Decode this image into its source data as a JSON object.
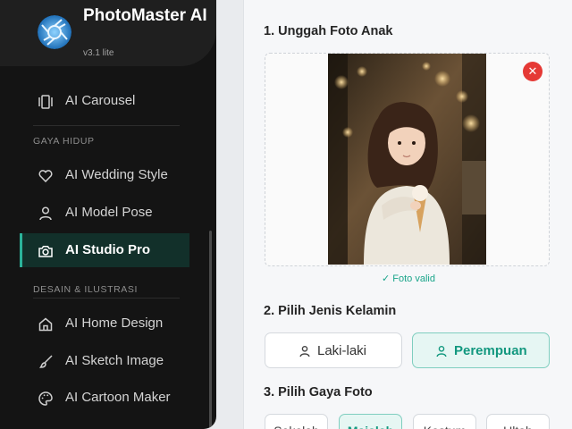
{
  "app": {
    "name": "PhotoMaster AI",
    "version": "v3.1 lite"
  },
  "sidebar": {
    "items": [
      {
        "label": "AI Carousel",
        "icon": "carousel-icon"
      },
      {
        "label": "AI Wedding Style",
        "icon": "heart-icon"
      },
      {
        "label": "AI Model Pose",
        "icon": "person-icon"
      },
      {
        "label": "AI Studio Pro",
        "icon": "camera-icon",
        "active": true
      },
      {
        "label": "AI Home Design",
        "icon": "home-icon"
      },
      {
        "label": "AI Sketch Image",
        "icon": "brush-icon"
      },
      {
        "label": "AI Cartoon Maker",
        "icon": "palette-icon"
      }
    ],
    "sections": [
      {
        "label": "GAYA HIDUP"
      },
      {
        "label": "DESAIN & ILUSTRASI"
      }
    ]
  },
  "main": {
    "upload": {
      "title": "1. Unggah Foto Anak",
      "remove_label": "✕",
      "status": "✓ Foto valid"
    },
    "gender": {
      "title": "2. Pilih Jenis Kelamin",
      "options": [
        {
          "label": "Laki-laki",
          "selected": false
        },
        {
          "label": "Perempuan",
          "selected": true
        }
      ]
    },
    "style": {
      "title": "3. Pilih Gaya Foto",
      "options": [
        {
          "label": "Sekolah",
          "selected": false
        },
        {
          "label": "Majalah",
          "selected": true
        },
        {
          "label": "Kostum",
          "selected": false
        },
        {
          "label": "Ultah",
          "selected": false
        }
      ]
    }
  },
  "colors": {
    "sidebar_bg": "#141414",
    "accent": "#13987f",
    "remove": "#e53935"
  }
}
